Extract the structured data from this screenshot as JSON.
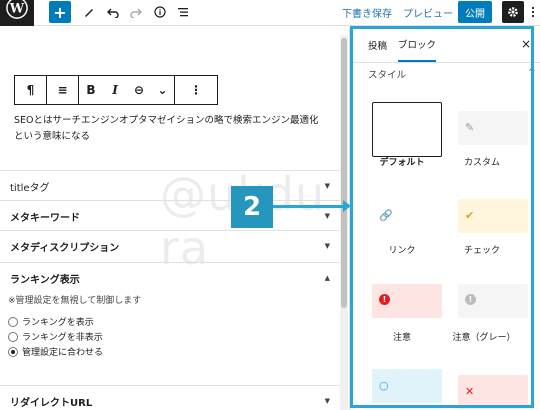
{
  "topbar": {
    "add_label": "+",
    "save_draft": "下書き保存",
    "preview": "プレビュー",
    "publish": "公開",
    "icons": [
      "wordpress-logo-icon",
      "plus-icon",
      "pencil-icon",
      "undo-icon",
      "redo-icon",
      "info-icon",
      "list-view-icon",
      "gear-icon",
      "more-vertical-icon"
    ]
  },
  "block_toolbar": {
    "items": [
      "¶",
      "≡",
      "B",
      "I",
      "⊖",
      "⌄",
      "⋮"
    ]
  },
  "editor": {
    "paragraph_line1": "SEOとはサーチエンジンオプタマゼイションの略で検索エンジン最適化",
    "paragraph_line2": "という意味になる",
    "watermark": "@ukdu ra"
  },
  "panels": {
    "title_tag": "titleタグ",
    "meta_keywords": "メタキーワード",
    "meta_description": "メタディスクリプション",
    "ranking": "ランキング表示",
    "ranking_note": "※管理設定を無視して制御します",
    "ranking_options": [
      "ランキングを表示",
      "ランキングを非表示",
      "管理設定に合わせる"
    ],
    "ranking_selected": 2,
    "redirect": "リダイレクトURL"
  },
  "sidebar": {
    "tab_post": "投稿",
    "tab_block": "ブロック",
    "close": "×",
    "style_label": "スタイル",
    "style_chevron": "^",
    "styles": [
      {
        "label": "デフォルト",
        "color": "#ffffff",
        "icon": "",
        "icon_color": ""
      },
      {
        "label": "カスタム",
        "color": "#f5f5f5",
        "icon": "✎",
        "icon_color": "#999999"
      },
      {
        "label": "リンク",
        "color": "#ffffff",
        "icon": "🔗",
        "icon_color": "#bbbbbb"
      },
      {
        "label": "チェック",
        "color": "#fff6dd",
        "icon": "✔",
        "icon_color": "#e0a020"
      },
      {
        "label": "注意",
        "color": "#ffe4e4",
        "icon": "!",
        "icon_color": "#e02020"
      },
      {
        "label": "注意（グレー）",
        "color": "#f5f5f5",
        "icon": "!",
        "icon_color": "#bbbbbb"
      },
      {
        "label": "",
        "color": "#e0f3fb",
        "icon": "○",
        "icon_color": "#2aa5d6"
      },
      {
        "label": "",
        "color": "#ffe4e4",
        "icon": "✕",
        "icon_color": "#e02020"
      }
    ]
  },
  "callout": {
    "number": "2",
    "color": "#2aa5d6"
  }
}
